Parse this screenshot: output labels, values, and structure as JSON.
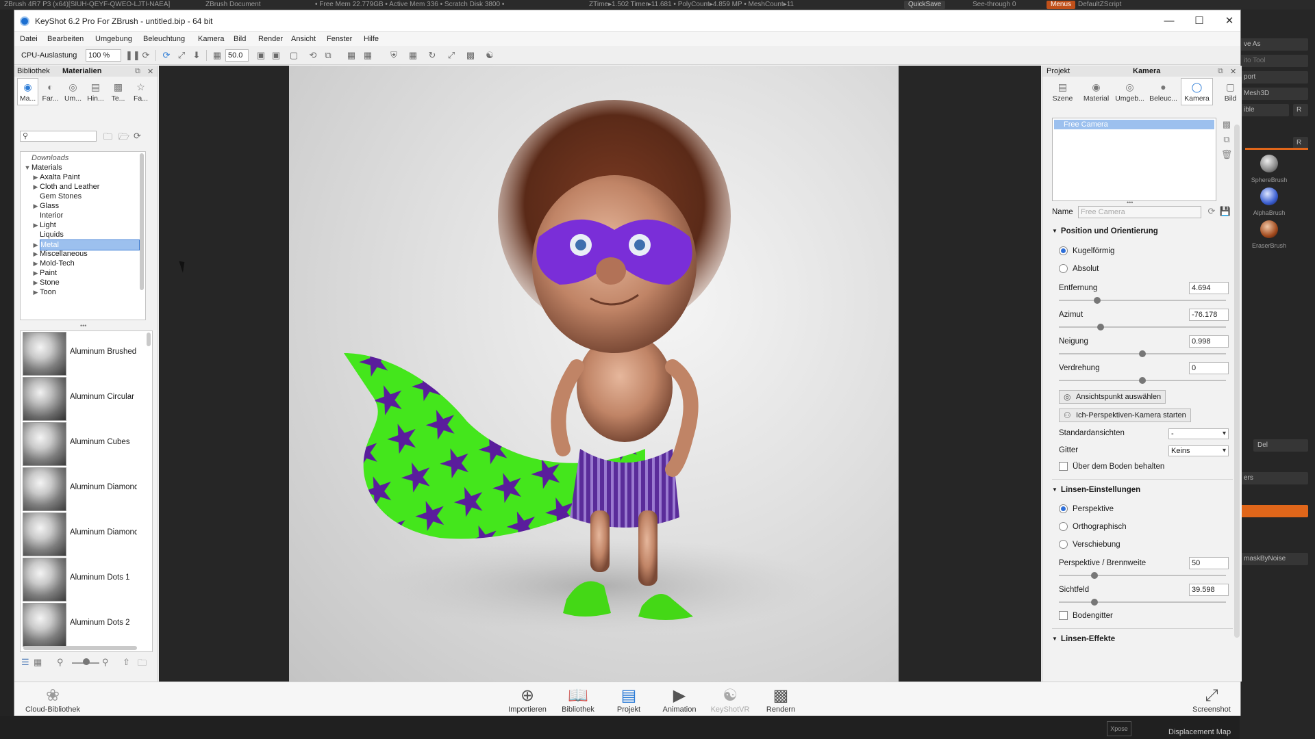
{
  "zbrush": {
    "topbar_items": [
      "ZBrush 4R7 P3 (x64)[SIUH-QEYF-QWEO-LJTI-NAEA]",
      "ZBrush Document",
      "• Free Mem 22.779GB • Active Mem 336 • Scratch Disk 3800 •",
      "ZTime▸1.502 Timer▸11.681 • PolyCount▸4.859 MP • MeshCount▸11"
    ],
    "quicksave": "QuickSave",
    "seethrough": "See-through   0",
    "menus": "Menus",
    "script": "DefaultZScript",
    "right_buttons": [
      "ve As",
      "ito Tool",
      "port",
      "Mesh3D",
      "ible",
      "",
      "",
      "",
      "Del",
      "",
      "ers",
      "",
      "",
      "maskByNoise"
    ],
    "r_labels": [
      "R",
      "R"
    ],
    "brushes": [
      "SphereBrush",
      "AlphaBrush",
      "EraserBrush"
    ],
    "bottom_label": "Displacement Map",
    "xpose": "Xpose"
  },
  "window": {
    "title": "KeyShot 6.2 Pro For ZBrush - untitled.bip - 64 bit",
    "minimize": "—",
    "maximize": "☐",
    "close": "✕"
  },
  "menu": [
    "Datei",
    "Bearbeiten",
    "Umgebung",
    "Beleuchtung",
    "Kamera",
    "Bild",
    "Render",
    "Ansicht",
    "Fenster",
    "Hilfe"
  ],
  "toolbar": {
    "cpu_label": "CPU-Auslastung",
    "cpu_value": "100 %",
    "fov_value": "50.0"
  },
  "left_panel": {
    "tabs": [
      "Bibliothek",
      "Materialien"
    ],
    "subtabs": [
      "Ma...",
      "Far...",
      "Um...",
      "Hin...",
      "Te...",
      "Fa..."
    ],
    "search_placeholder": "",
    "tree": [
      {
        "label": "Downloads",
        "arrow": "",
        "indent": 0,
        "italic": true
      },
      {
        "label": "Materials",
        "arrow": "▼",
        "indent": 0
      },
      {
        "label": "Axalta Paint",
        "arrow": "▶",
        "indent": 1
      },
      {
        "label": "Cloth and Leather",
        "arrow": "▶",
        "indent": 1
      },
      {
        "label": "Gem Stones",
        "arrow": "",
        "indent": 1
      },
      {
        "label": "Glass",
        "arrow": "▶",
        "indent": 1
      },
      {
        "label": "Interior",
        "arrow": "",
        "indent": 1
      },
      {
        "label": "Light",
        "arrow": "▶",
        "indent": 1
      },
      {
        "label": "Liquids",
        "arrow": "",
        "indent": 1
      },
      {
        "label": "Metal",
        "arrow": "▶",
        "indent": 1,
        "selected": true
      },
      {
        "label": "Miscellaneous",
        "arrow": "▶",
        "indent": 1
      },
      {
        "label": "Mold-Tech",
        "arrow": "▶",
        "indent": 1
      },
      {
        "label": "Paint",
        "arrow": "▶",
        "indent": 1
      },
      {
        "label": "Stone",
        "arrow": "▶",
        "indent": 1
      },
      {
        "label": "Toon",
        "arrow": "▶",
        "indent": 1
      }
    ],
    "materials": [
      "Aluminum Brushed",
      "Aluminum Circular Me",
      "Aluminum Cubes",
      "Aluminum Diamond P",
      "Aluminum Diamond P",
      "Aluminum Dots 1",
      "Aluminum Dots 2"
    ]
  },
  "right_panel": {
    "tabs": [
      "Projekt",
      "Kamera"
    ],
    "subtabs": [
      "Szene",
      "Material",
      "Umgeb...",
      "Beleuc...",
      "Kamera",
      "Bild"
    ],
    "camera_list": [
      "Free Camera"
    ],
    "name_label": "Name",
    "name_value": "Free Camera",
    "sec_position": "Position und Orientierung",
    "radio_spherical": "Kugelförmig",
    "radio_absolute": "Absolut",
    "entfernung_label": "Entfernung",
    "entfernung_value": "4.694",
    "entfernung_level": 0.22,
    "azimut_label": "Azimut",
    "azimut_value": "-76.178",
    "azimut_level": 0.24,
    "neigung_label": "Neigung",
    "neigung_value": "0.998",
    "neigung_level": 0.5,
    "verdrehung_label": "Verdrehung",
    "verdrehung_value": "0",
    "verdrehung_level": 0.5,
    "btn_viewpoint": "Ansichtspunkt auswählen",
    "btn_firstperson": "Ich-Perspektiven-Kamera starten",
    "std_label": "Standardansichten",
    "std_value": "-",
    "grid_label": "Gitter",
    "grid_value": "Keins",
    "above_ground": "Über dem Boden behalten",
    "sec_lens": "Linsen-Einstellungen",
    "radio_persp": "Perspektive",
    "radio_ortho": "Orthographisch",
    "radio_shift": "Verschiebung",
    "focal_label": "Perspektive / Brennweite",
    "focal_value": "50",
    "focal_level": 0.2,
    "fov_label": "Sichtfeld",
    "fov_value": "39.598",
    "fov_level": 0.2,
    "floor_grid": "Bodengitter",
    "sec_effects": "Linsen-Effekte"
  },
  "bottom_bar": {
    "cloud": "Cloud-Bibliothek",
    "items": [
      "Importieren",
      "Bibliothek",
      "Projekt",
      "Animation",
      "KeyShotVR",
      "Rendern"
    ],
    "screenshot": "Screenshot"
  },
  "colors": {
    "accent": "#2b7bd6",
    "selection": "#9cc0ee",
    "cape_green": "#44e61c",
    "cape_stars": "#5a1d9c",
    "mask_purple": "#7a2ed8",
    "zbrush_orange": "#e0661a"
  }
}
